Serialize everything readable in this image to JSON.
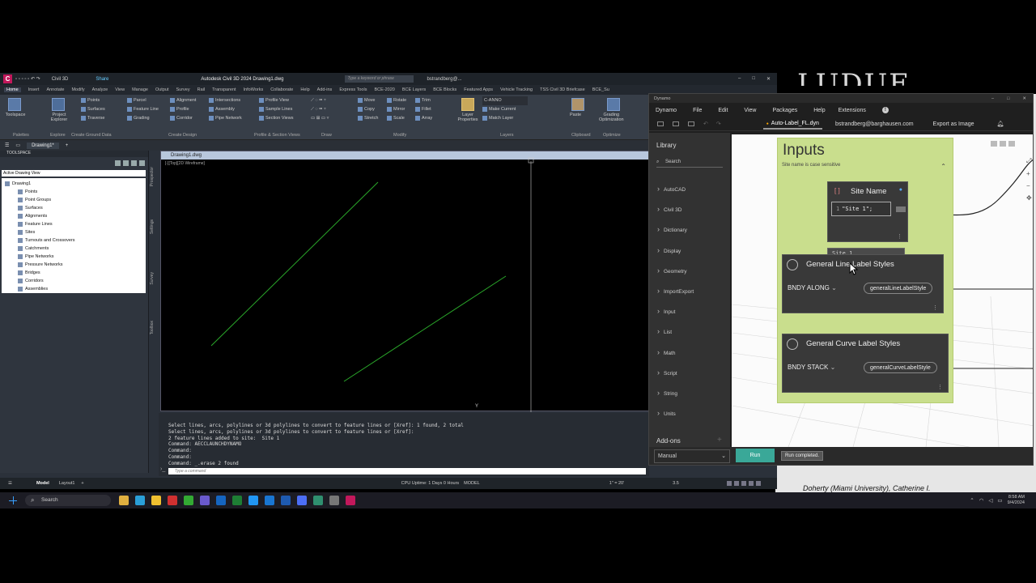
{
  "background": {
    "bgtext": "LUDUE",
    "citation": "Doherty (Miami University), Catherine I."
  },
  "acad": {
    "app_title": "Autodesk Civil 3D 2024   Drawing1.dwg",
    "workspace": "Civil 3D",
    "share": "Share",
    "search_placeholder": "Type a keyword or phrase",
    "user": "bstrandberg@...",
    "ribbon_tabs": [
      "Home",
      "Insert",
      "Annotate",
      "Modify",
      "Analyze",
      "View",
      "Manage",
      "Output",
      "Survey",
      "Rail",
      "Transparent",
      "InfoWorks",
      "Collaborate",
      "Help",
      "Add-ins",
      "Express Tools",
      "BCE-2020",
      "BCE Layers",
      "BCE Blocks",
      "Featured Apps",
      "Vehicle Tracking",
      "TSS Civil 3D Briefcase",
      "BCE_Su"
    ],
    "ribbon": {
      "toolspace": "Toolspace",
      "project_explorer": "Project\nExplorer",
      "col1": [
        "Points",
        "Surfaces",
        "Traverse"
      ],
      "col2": [
        "Parcel",
        "Feature Line",
        "Grading"
      ],
      "col3": [
        "Alignment",
        "Profile",
        "Corridor"
      ],
      "col4": [
        "Intersections",
        "Assembly",
        "Pipe Network"
      ],
      "col5": [
        "Profile View",
        "Sample Lines",
        "Section Views"
      ],
      "modify_col1": [
        "Move",
        "Copy",
        "Stretch"
      ],
      "modify_col2": [
        "Rotate",
        "Mirror",
        "Scale"
      ],
      "modify_col3": [
        "Trim",
        "Fillet",
        "Array"
      ],
      "layer_props": "Layer\nProperties",
      "layer_name": "C-ANNO",
      "layers_col": [
        "Make Current",
        "Match Layer"
      ],
      "paste": "Paste",
      "grading_opt": "Grading\nOptimization",
      "panels": [
        "Palettes",
        "Explore",
        "Create Ground Data",
        "Create Design",
        "Profile & Section Views",
        "Draw",
        "Modify",
        "Layers",
        "Clipboard",
        "Optimize"
      ]
    },
    "doc_tab": "Drawing1*",
    "toolspace": {
      "header": "TOOLSPACE",
      "view": "Active Drawing View",
      "tree": [
        "Drawing1",
        "Points",
        "Point Groups",
        "Surfaces",
        "Alignments",
        "Feature Lines",
        "Sites",
        "Turnouts and Crossovers",
        "Catchments",
        "Pipe Networks",
        "Pressure Networks",
        "Bridges",
        "Corridors",
        "Assemblies"
      ],
      "side": [
        "Prospector",
        "Settings",
        "Survey",
        "Toolbox"
      ]
    },
    "viewport": {
      "tab": "Drawing1.dwg",
      "label": "[-][Top][2D Wireframe]"
    },
    "command_history": "Select lines, arcs, polylines or 3d polylines to convert to feature lines or [Xref]: 1 found, 2 total\nSelect lines, arcs, polylines or 3d polylines to convert to feature lines or [Xref]:\n2 feature lines added to site:  Site 1\nCommand: AECCLAUNCHDYNAMO\nCommand:\nCommand:\nCommand: _.erase 2 found",
    "command_placeholder": "Type a command",
    "status": {
      "model_tab": "Model",
      "layout_tab": "Layout1",
      "cpu": "CPU Uptime: 1 Days 0 Hours",
      "model": "MODEL",
      "scale": "1\" = 20'",
      "ann": "3.5"
    }
  },
  "dynamo": {
    "title": "Dynamo",
    "menu": [
      "Dynamo",
      "File",
      "Edit",
      "View",
      "Packages",
      "Help"
    ],
    "extensions": "Extensions",
    "file_tab": "Auto-Label_FL.dyn",
    "user": "bstrandberg@barghausen.com",
    "export": "Export as Image",
    "library": {
      "title": "Library",
      "search": "Search",
      "categories": [
        "AutoCAD",
        "Civil 3D",
        "Dictionary",
        "Display",
        "Geometry",
        "ImportExport",
        "Input",
        "List",
        "Math",
        "Script",
        "String",
        "Units"
      ],
      "addons": "Add-ons"
    },
    "group": {
      "title": "Inputs",
      "description": "Site name is case sensitive"
    },
    "site_name_node": {
      "title": "Site Name",
      "code_line": "1",
      "code": "\"Site 1\";",
      "preview": "Site 1"
    },
    "line_label_node": {
      "title": "General Line Label Styles",
      "selected": "BNDY ALONG",
      "output": "generalLineLabelStyle"
    },
    "curve_label_node": {
      "title": "General Curve Label Styles",
      "selected": "BNDY STACK",
      "output": "generalCurveLabelStyle"
    },
    "run_mode": "Manual",
    "run_button": "Run",
    "run_status": "Run completed."
  },
  "taskbar": {
    "search": "Search",
    "time": "8:58 AM",
    "date": "9/4/2024"
  }
}
